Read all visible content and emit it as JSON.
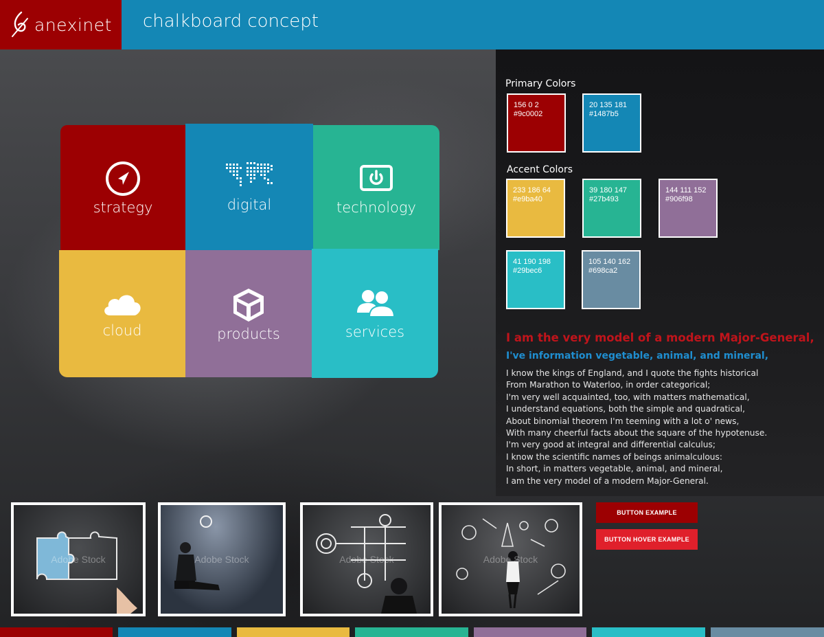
{
  "header": {
    "brand": "anexinet",
    "title": "chalkboard concept",
    "colors": {
      "bar": "#1487b5",
      "brand_block": "#9c0002"
    }
  },
  "tiles": [
    {
      "label": "strategy",
      "icon": "compass-icon",
      "color": "#9c0002"
    },
    {
      "label": "digital",
      "icon": "world-map-icon",
      "color": "#1487b5"
    },
    {
      "label": "technology",
      "icon": "power-icon",
      "color": "#27b493"
    },
    {
      "label": "cloud",
      "icon": "cloud-icon",
      "color": "#e9ba40"
    },
    {
      "label": "products",
      "icon": "box-icon",
      "color": "#906f98"
    },
    {
      "label": "services",
      "icon": "people-icon",
      "color": "#29bec6"
    }
  ],
  "palette": {
    "primary_label": "Primary Colors",
    "primary": [
      {
        "rgb": "156  0  2",
        "hex": "#9c0002"
      },
      {
        "rgb": "20 135 181",
        "hex": "#1487b5"
      }
    ],
    "accent_label": "Accent Colors",
    "accent": [
      {
        "rgb": "233 186 64",
        "hex": "#e9ba40"
      },
      {
        "rgb": "39 180 147",
        "hex": "#27b493"
      },
      {
        "rgb": "144 111 152",
        "hex": "#906f98"
      },
      {
        "rgb": "41 190 198",
        "hex": "#29bec6"
      },
      {
        "rgb": "105 140 162",
        "hex": "#698ca2"
      }
    ]
  },
  "typography": {
    "heading": "I am the very model of a modern Major-General,",
    "subheading": "I've information vegetable, animal, and mineral,",
    "body": [
      "I know the kings of England, and I quote the fights historical",
      "From Marathon to Waterloo, in order categorical;",
      "I'm very well acquainted, too, with matters mathematical,",
      "I understand equations, both the simple and quadratical,",
      "About binomial theorem I'm teeming with a lot o' news,",
      "With many cheerful facts about the square of the hypotenuse.",
      "I'm very good at integral and differential calculus;",
      "I know the scientific names of beings animalculous:",
      "In short, in matters vegetable, animal, and mineral,",
      "I am the very model of a modern Major-General."
    ],
    "colors": {
      "heading": "#c0141b",
      "subheading": "#1f8ed0"
    }
  },
  "photos": [
    {
      "subject": "puzzle-pieces-chalk",
      "watermark": "Adobe Stock"
    },
    {
      "subject": "businessman-lightbulb",
      "watermark": "Adobe Stock"
    },
    {
      "subject": "businessman-diagram",
      "watermark": "Adobe Stock"
    },
    {
      "subject": "businesswoman-sketches",
      "watermark": "Adobe Stock"
    }
  ],
  "buttons": {
    "example": "BUTTON EXAMPLE",
    "hover_example": "BUTTON HOVER EXAMPLE",
    "colors": {
      "normal": "#9c0002",
      "hover": "#e0202b"
    }
  },
  "footer_strip": [
    "#9c0002",
    "#1487b5",
    "#e9ba40",
    "#27b493",
    "#906f98",
    "#29bec6",
    "#698ca2"
  ]
}
